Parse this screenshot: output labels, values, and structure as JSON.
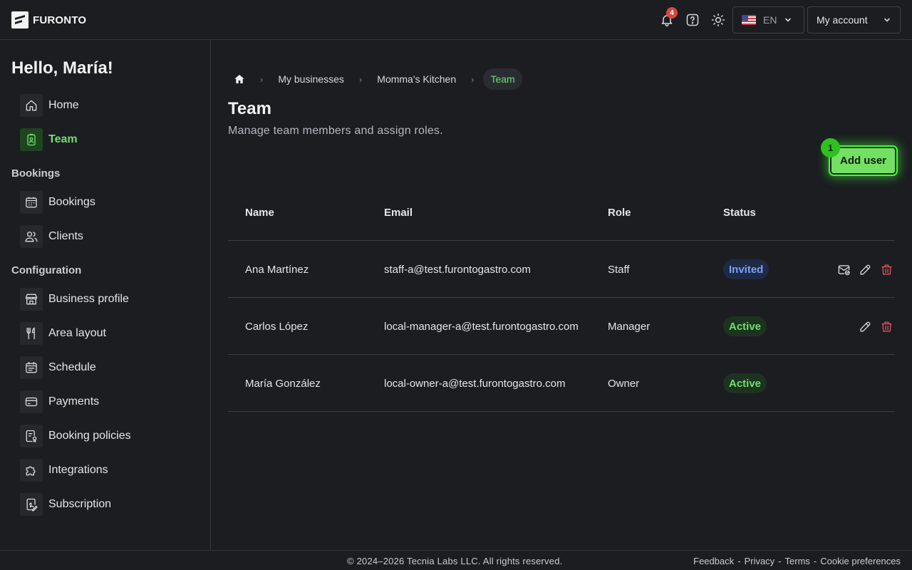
{
  "header": {
    "logo_text": "FURONTO",
    "notifications_count": "4",
    "language": "EN",
    "account_label": "My account"
  },
  "sidebar": {
    "greeting": "Hello, María!",
    "items_top": [
      {
        "label": "Home",
        "icon": "home-icon",
        "active": false
      },
      {
        "label": "Team",
        "icon": "team-badge-icon",
        "active": true
      }
    ],
    "sections": [
      {
        "title": "Bookings",
        "items": [
          {
            "label": "Bookings",
            "icon": "calendar-icon"
          },
          {
            "label": "Clients",
            "icon": "users-icon"
          }
        ]
      },
      {
        "title": "Configuration",
        "items": [
          {
            "label": "Business profile",
            "icon": "storefront-icon"
          },
          {
            "label": "Area layout",
            "icon": "utensils-icon"
          },
          {
            "label": "Schedule",
            "icon": "schedule-icon"
          },
          {
            "label": "Payments",
            "icon": "credit-card-icon"
          },
          {
            "label": "Booking policies",
            "icon": "policy-icon"
          },
          {
            "label": "Integrations",
            "icon": "puzzle-icon"
          },
          {
            "label": "Subscription",
            "icon": "subscription-icon"
          }
        ]
      }
    ]
  },
  "breadcrumb": {
    "items": [
      "My businesses",
      "Momma's Kitchen"
    ],
    "current": "Team"
  },
  "page": {
    "title": "Team",
    "subtitle": "Manage team members and assign roles.",
    "add_user_label": "Add user",
    "step_badge": "1"
  },
  "table": {
    "headers": {
      "name": "Name",
      "email": "Email",
      "role": "Role",
      "status": "Status"
    },
    "rows": [
      {
        "name": "Ana Martínez",
        "email": "staff-a@test.furontogastro.com",
        "role": "Staff",
        "status": "Invited",
        "actions": [
          "resend-invite",
          "edit",
          "delete"
        ]
      },
      {
        "name": "Carlos López",
        "email": "local-manager-a@test.furontogastro.com",
        "role": "Manager",
        "status": "Active",
        "actions": [
          "edit",
          "delete"
        ]
      },
      {
        "name": "María González",
        "email": "local-owner-a@test.furontogastro.com",
        "role": "Owner",
        "status": "Active",
        "actions": []
      }
    ]
  },
  "footer": {
    "copyright": "© 2024–2026 Tecnia Labs LLC. All rights reserved.",
    "links": [
      "Feedback",
      "Privacy",
      "Terms",
      "Cookie preferences"
    ]
  },
  "colors": {
    "accent": "#6ee06a",
    "background": "#1b1d21",
    "danger": "#e05555",
    "invited": "#7aa2f5"
  }
}
